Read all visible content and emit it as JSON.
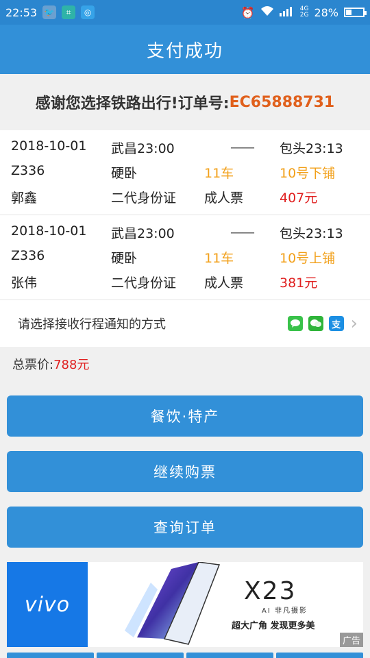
{
  "status_bar": {
    "time": "22:53",
    "net_label_top": "4G",
    "net_label_bottom": "2G",
    "battery": "28%",
    "icons": [
      "bird-app-icon",
      "scan-app-icon",
      "camera-app-icon",
      "alarm-icon",
      "wifi-icon",
      "signal-icon",
      "battery-icon"
    ]
  },
  "header": {
    "title": "支付成功"
  },
  "thanks": {
    "prefix": "感谢您选择铁路出行!订单号:",
    "order_no": "EC65888731"
  },
  "tickets": [
    {
      "date": "2018-10-01",
      "from": "武昌23:00",
      "arrow": "——",
      "to": "包头23:13",
      "train": "Z336",
      "seat_type": "硬卧",
      "car": "11车",
      "berth": "10号下铺",
      "passenger": "郭鑫",
      "id_type": "二代身份证",
      "ticket_type": "成人票",
      "price": "407元"
    },
    {
      "date": "2018-10-01",
      "from": "武昌23:00",
      "arrow": "——",
      "to": "包头23:13",
      "train": "Z336",
      "seat_type": "硬卧",
      "car": "11车",
      "berth": "10号上铺",
      "passenger": "张伟",
      "id_type": "二代身份证",
      "ticket_type": "成人票",
      "price": "381元"
    }
  ],
  "notify": {
    "label": "请选择接收行程通知的方式",
    "icons": [
      "sms-icon",
      "wechat-icon",
      "alipay-icon"
    ],
    "alipay_glyph": "支"
  },
  "total": {
    "label": "总票价:",
    "value": "788元"
  },
  "buttons": {
    "food": "餐饮·特产",
    "continue": "继续购票",
    "query": "查询订单"
  },
  "ad": {
    "brand": "vivo",
    "model": "X23",
    "tagline1": "AI 非凡摄影",
    "tagline2": "超大广角 发现更多美",
    "ad_tag": "广告"
  },
  "colors": {
    "primary": "#3290d8",
    "status_bar": "#2b86cf",
    "order_no": "#e0601c",
    "car_berth": "#f2a01a",
    "price": "#e02020"
  }
}
